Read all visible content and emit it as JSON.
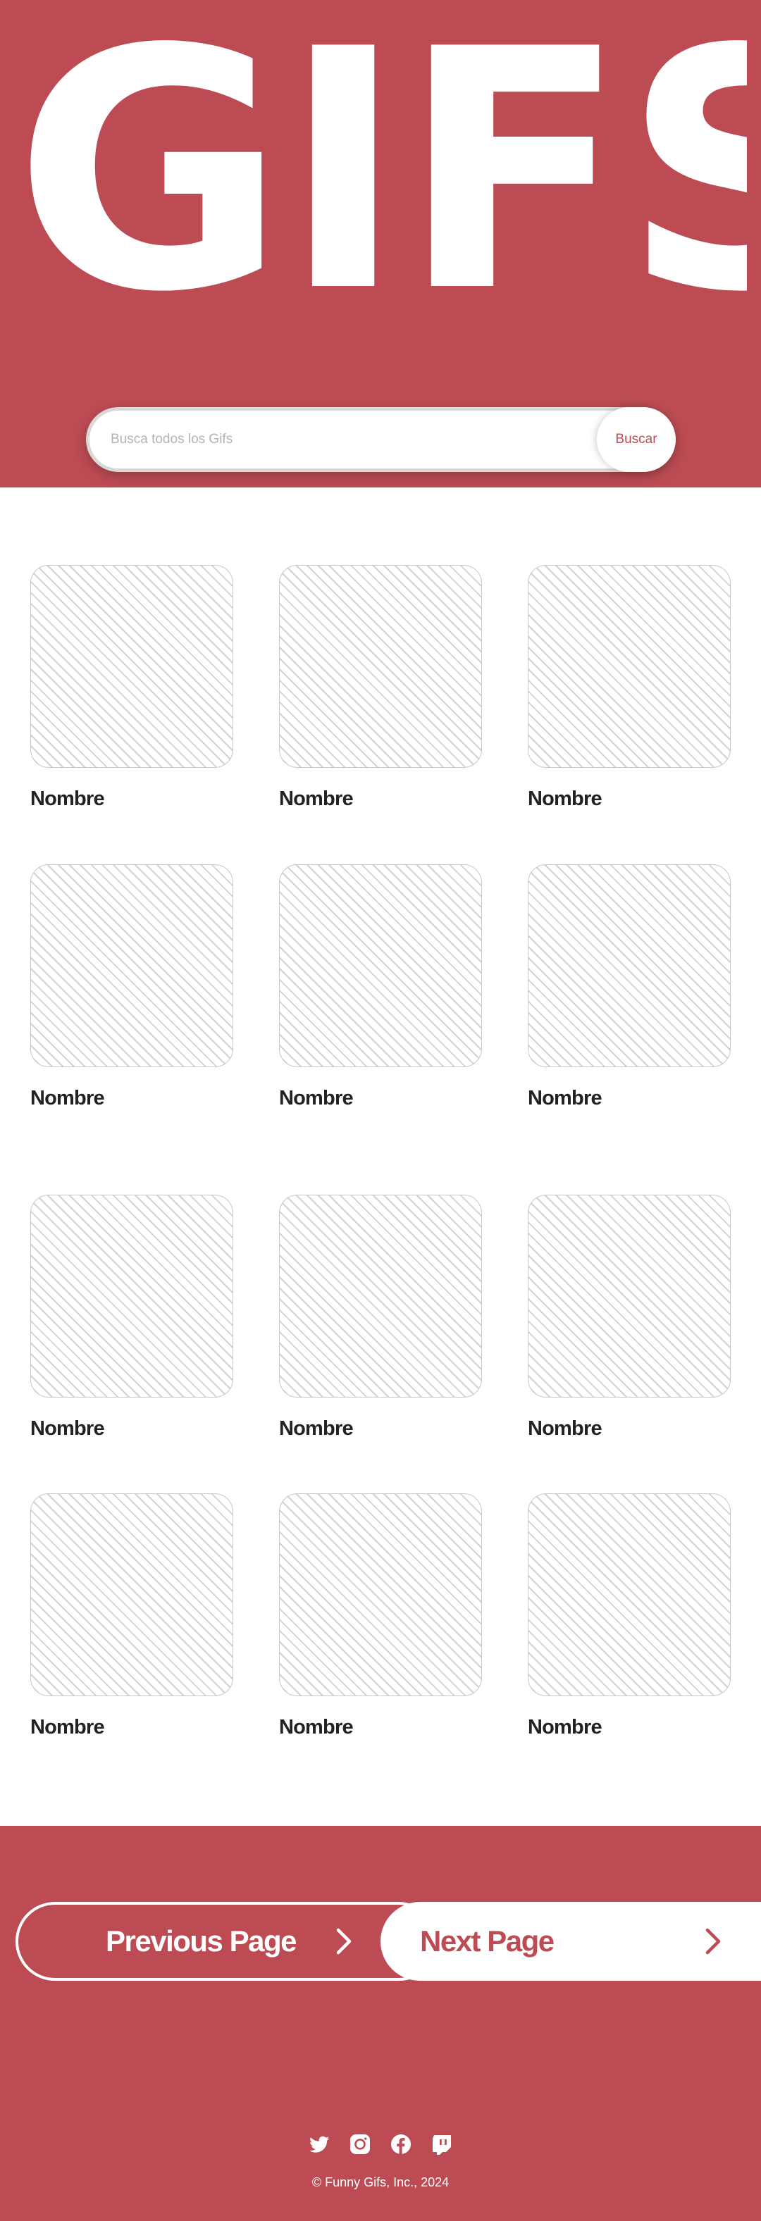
{
  "header": {
    "logo_text": "GIFS",
    "search": {
      "placeholder": "Busca todos los Gifs",
      "value": "",
      "button_label": "Buscar"
    }
  },
  "gifs": [
    {
      "name": "Nombre"
    },
    {
      "name": "Nombre"
    },
    {
      "name": "Nombre"
    },
    {
      "name": "Nombre"
    },
    {
      "name": "Nombre"
    },
    {
      "name": "Nombre"
    },
    {
      "name": "Nombre"
    },
    {
      "name": "Nombre"
    },
    {
      "name": "Nombre"
    },
    {
      "name": "Nombre"
    },
    {
      "name": "Nombre"
    },
    {
      "name": "Nombre"
    }
  ],
  "pagination": {
    "previous_label": "Previous Page",
    "next_label": "Next Page"
  },
  "footer": {
    "social_icons": [
      "twitter-icon",
      "instagram-icon",
      "facebook-icon",
      "twitch-icon"
    ],
    "copyright": "© Funny Gifs, Inc., 2024"
  },
  "colors": {
    "brand": "#bc4b53",
    "text_dark": "#222222",
    "placeholder": "#b3b3b3",
    "white": "#ffffff"
  }
}
